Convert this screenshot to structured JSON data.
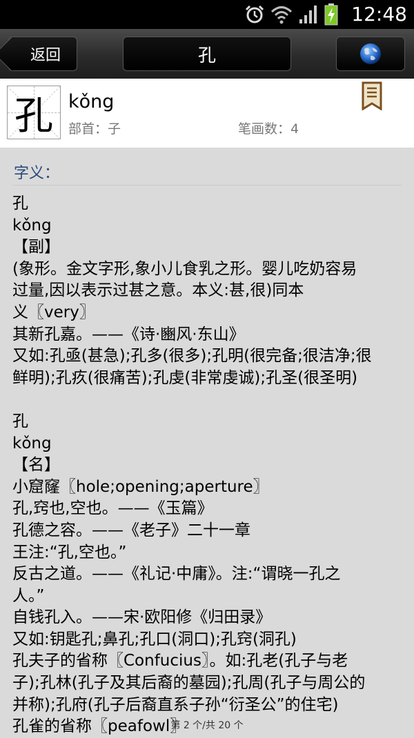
{
  "status_bar": {
    "time": "12:48",
    "icons": [
      "alarm-icon",
      "wifi-icon",
      "signal-icon",
      "battery-charging-icon"
    ]
  },
  "action_bar": {
    "back_label": "返回",
    "title": "孔",
    "globe_icon": "globe-icon"
  },
  "header": {
    "character": "孔",
    "pinyin": "kǒng",
    "radical": "部首：子",
    "strokes": "笔画数：4",
    "bookmark_icon": "bookmark-icon"
  },
  "definitions": {
    "title": "字义：",
    "lines": [
      "孔",
      "kǒng",
      "【副】",
      "(象形。金文字形,象小儿食乳之形。婴儿吃奶容易",
      "过量,因以表示过甚之意。本义:甚,很)同本",
      "义〖very〗",
      "其新孔嘉。——《诗·豳风·东山》",
      "又如:孔亟(甚急);孔多(很多);孔明(很完备;很洁净;很",
      "鲜明);孔疚(很痛苦);孔虔(非常虔诚);孔圣(很圣明)",
      "",
      "孔",
      "kǒng",
      "【名】",
      "小窟窿〖hole;opening;aperture〗",
      "孔,窍也,空也。——《玉篇》",
      "孔德之容。——《老子》二十一章",
      "王注:“孔,空也。”",
      "反古之道。——《礼记·中庸》。注:“谓晓一孔之",
      "人。”",
      "自钱孔入。——宋·欧阳修《归田录》",
      "又如:钥匙孔;鼻孔;孔口(洞口);孔窍(洞孔)",
      "孔夫子的省称〖Confucius〗。如:孔老(孔子与老",
      "子);孔林(孔子及其后裔的墓园);孔周(孔子与周公的",
      "并称);孔府(孔子后裔直系子孙“衍圣公”的住宅)",
      "孔雀的省称〖peafowl〗"
    ]
  },
  "pager": {
    "text": "第 2 个/共 20 个"
  },
  "colors": {
    "section_title": "#2a4a7a",
    "background": "#dadada"
  }
}
